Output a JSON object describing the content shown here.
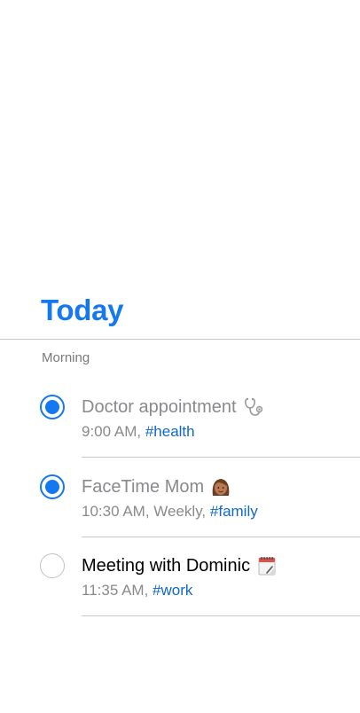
{
  "header": {
    "title": "Today"
  },
  "section": {
    "label": "Morning"
  },
  "tasks": [
    {
      "name": "Doctor appointment",
      "emoji_icon": "stethoscope-icon",
      "meta_prefix": "9:00 AM, ",
      "tag": "#health",
      "completed": true
    },
    {
      "name": "FaceTime Mom",
      "emoji_icon": "woman-face-icon",
      "meta_prefix": "10:30 AM, Weekly, ",
      "tag": "#family",
      "completed": true
    },
    {
      "name": "Meeting with Dominic",
      "emoji_icon": "notepad-icon",
      "meta_prefix": "11:35 AM, ",
      "tag": "#work",
      "completed": false
    }
  ],
  "colors": {
    "accent": "#1478F0",
    "tag": "#1068C8",
    "muted_text": "#8a8a8e",
    "divider": "#c8c8cc"
  }
}
